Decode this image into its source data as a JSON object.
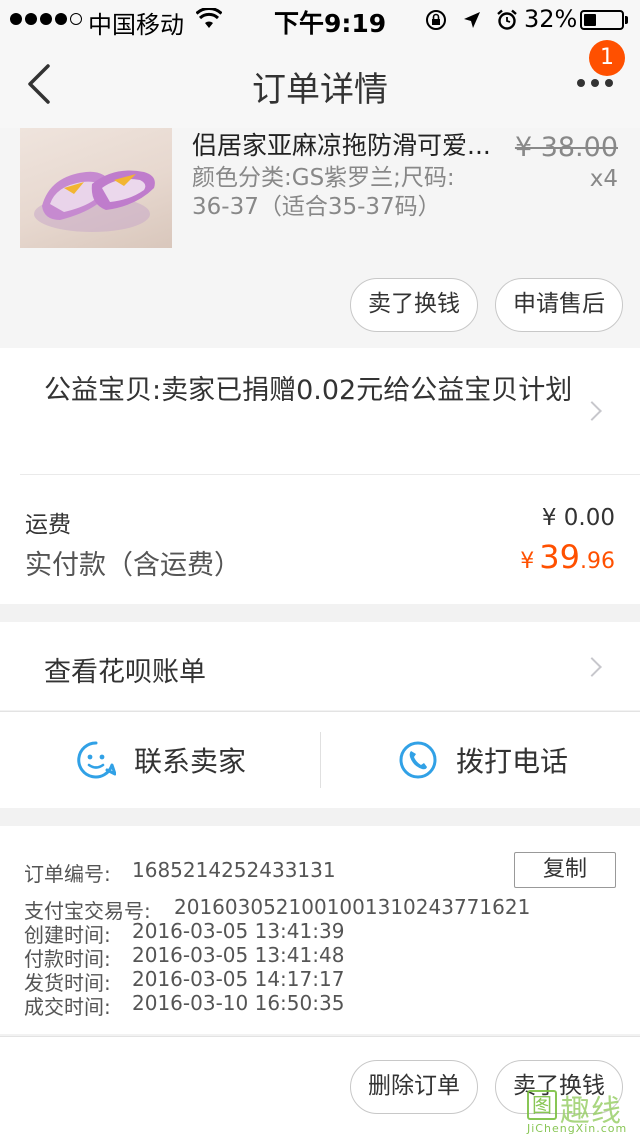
{
  "status_bar": {
    "carrier": "中国移动",
    "time": "下午9:19",
    "battery_text": "32%",
    "battery_level": 0.32
  },
  "nav": {
    "title": "订单详情",
    "badge_count": "1"
  },
  "product": {
    "name": "侣居家亚麻凉拖防滑可爱...",
    "spec": "颜色分类:GS紫罗兰;尺码: 36-37（适合35-37码）",
    "price": "¥ 38.00",
    "quantity": "x4",
    "buttons": {
      "sell": "卖了换钱",
      "after_sale": "申请售后"
    }
  },
  "charity": {
    "text": "公益宝贝:卖家已捐赠0.02元给公益宝贝计划"
  },
  "totals": {
    "freight_label": "运费",
    "freight_value": "¥ 0.00",
    "paid_label": "实付款（含运费）",
    "paid_currency": "¥",
    "paid_integer": "39",
    "paid_decimal": ".96"
  },
  "huabei": {
    "label": "查看花呗账单"
  },
  "contact": {
    "seller_label": "联系卖家",
    "phone_label": "拨打电话"
  },
  "order_info": {
    "order_no_label": "订单编号:",
    "order_no": "1685214252433131",
    "copy_label": "复制",
    "alipay_label": "支付宝交易号:",
    "alipay_no": "2016030521001001310243771621",
    "created_label": "创建时间:",
    "created": "2016-03-05 13:41:39",
    "paid_label": "付款时间:",
    "paid": "2016-03-05 13:41:48",
    "shipped_label": "发货时间:",
    "shipped": "2016-03-05 14:17:17",
    "closed_label": "成交时间:",
    "closed": "2016-03-10 16:50:35"
  },
  "bottom": {
    "delete_label": "删除订单",
    "sell_label": "卖了换钱"
  },
  "watermark": {
    "box_char": "图",
    "text": "趣线",
    "url": "JiChengXin.com"
  },
  "colors": {
    "accent": "#ff5000",
    "seller_icon": "#31a1e6"
  },
  "icons": {
    "back": "chevron-left-icon",
    "more": "more-icon",
    "seller": "smiley-chat-icon",
    "phone": "phone-icon"
  }
}
